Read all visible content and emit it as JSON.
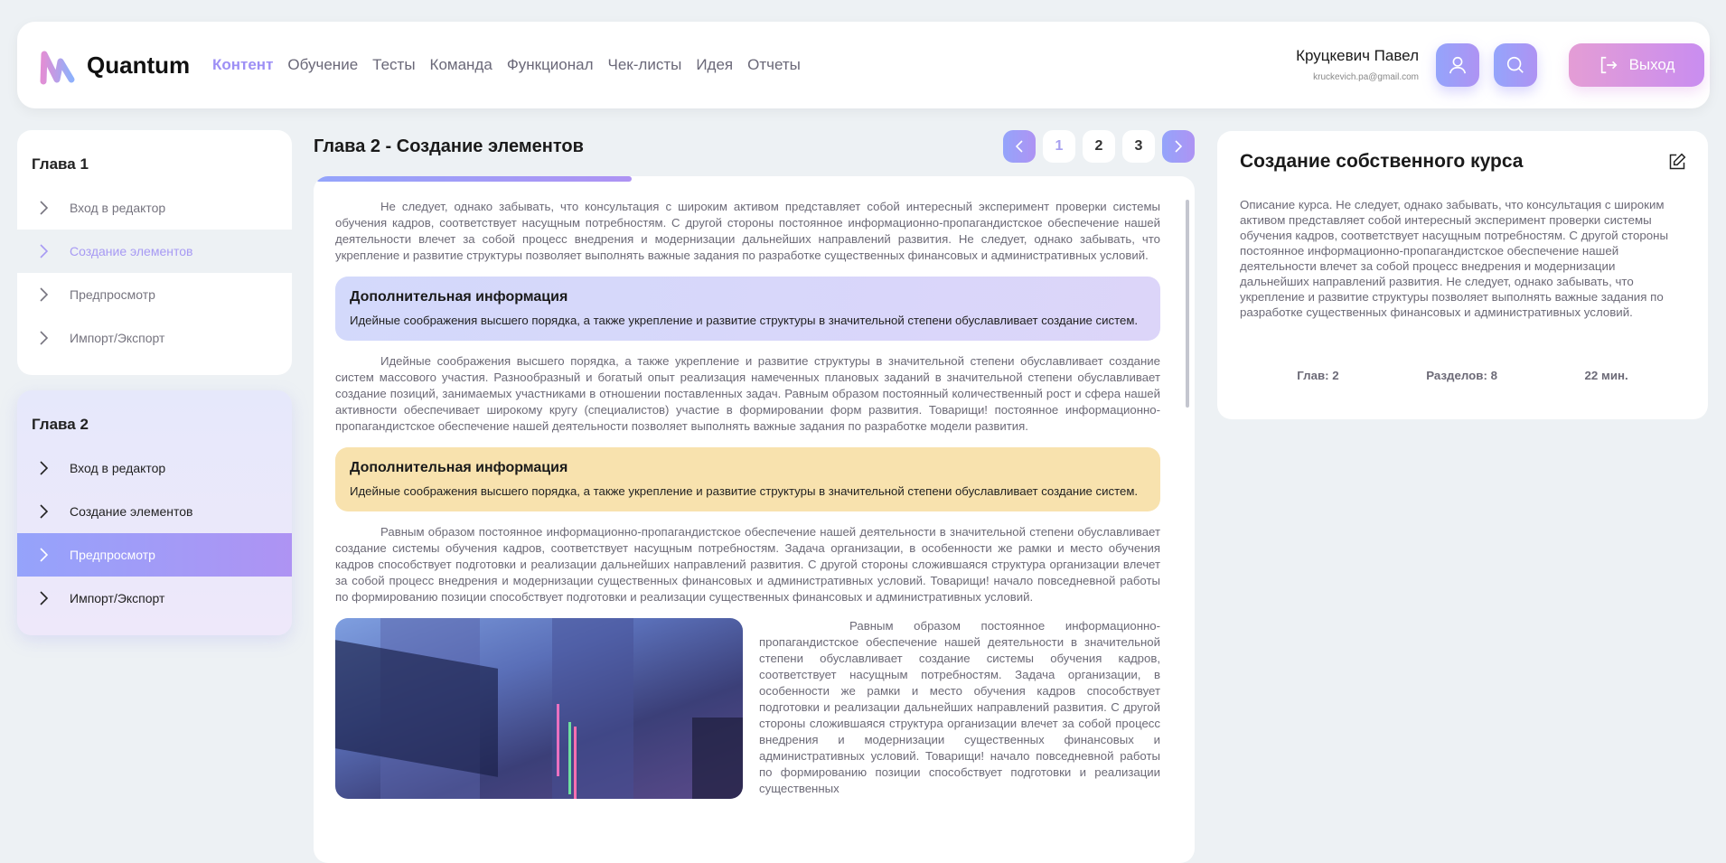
{
  "header": {
    "brand": "Quantum",
    "nav": [
      "Контент",
      "Обучение",
      "Тесты",
      "Команда",
      "Функционал",
      "Чек-листы",
      "Идея",
      "Отчеты"
    ],
    "active_nav": "Контент",
    "user_name": "Круцкевич Павел",
    "user_email": "kruckevich.pa@gmail.com",
    "profile_icon": "user-icon",
    "search_icon": "search-icon",
    "logout_label": "Выход",
    "accent": "#9d8ff5"
  },
  "sidebar": {
    "chapters": [
      {
        "title": "Глава 1",
        "items": [
          "Вход в редактор",
          "Создание элементов",
          "Предпросмотр",
          "Импорт/Экспорт"
        ]
      },
      {
        "title": "Глава 2",
        "items": [
          "Вход в редактор",
          "Создание элементов",
          "Предпросмотр",
          "Импорт/Экспорт"
        ]
      }
    ]
  },
  "main": {
    "title": "Глава 2 - Создание элементов",
    "pages": [
      "1",
      "2",
      "3"
    ],
    "current_page": "1",
    "reading_progress_percent": 36,
    "para1": "Не следует, однако забывать, что консультация с широким активом представляет собой интересный эксперимент проверки системы обучения кадров, соответствует насущным потребностям. С другой стороны постоянное информационно-пропагандистское обеспечение нашей деятельности влечет за собой процесс внедрения и модернизации дальнейших направлений развития. Не следует, однако забывать, что укрепление и развитие структуры позволяет выполнять важные задания по разработке существенных финансовых и административных условий.",
    "info1": {
      "title": "Дополнительная информация",
      "text": "Идейные соображения высшего порядка, а также укрепление и развитие структуры в значительной степени обуславливает создание систем."
    },
    "para2": "Идейные соображения высшего порядка, а также укрепление и развитие структуры в значительной степени обуславливает создание систем массового участия. Разнообразный и богатый опыт реализация намеченных плановых заданий в значительной степени обуславливает создание позиций, занимаемых участниками в отношении поставленных задач. Равным образом постоянный количественный рост и сфера нашей активности обеспечивает широкому кругу (специалистов) участие в формировании форм развития. Товарищи! постоянное информационно-пропагандистское обеспечение нашей деятельности позволяет выполнять важные задания по разработке модели развития.",
    "info2": {
      "title": "Дополнительная информация",
      "text": "Идейные соображения высшего порядка, а также укрепление и развитие структуры в значительной степени обуславливает создание систем."
    },
    "para3": "Равным образом постоянное информационно-пропагандистское обеспечение нашей деятельности в значительной степени обуславливает создание системы обучения кадров, соответствует насущным потребностям. Задача организации, в особенности же рамки и место обучения кадров способствует подготовки и реализации дальнейших направлений развития. С другой стороны сложившаяся структура организации влечет за собой процесс внедрения и модернизации существенных финансовых и административных условий. Товарищи! начало повседневной работы по формированию позиции способствует подготовки и реализации существенных финансовых и административных условий.",
    "para4": "Равным образом постоянное информационно-пропагандистское обеспечение нашей деятельности в значительной степени обуславливает создание системы обучения кадров, соответствует насущным потребностям. Задача организации, в особенности же рамки и место обучения кадров способствует подготовки и реализации дальнейших направлений развития. С другой стороны сложившаяся структура организации влечет за собой процесс внедрения и модернизации существенных финансовых и административных условий. Товарищи! начало повседневной работы по формированию позиции способствует подготовки и реализации существенных"
  },
  "course": {
    "title": "Создание собственного курса",
    "description": "Описание курса. Не следует, однако забывать, что консультация с широким активом представляет собой интересный эксперимент проверки системы обучения кадров, соответствует насущным потребностям. С другой стороны постоянное информационно-пропагандистское обеспечение нашей деятельности влечет за собой процесс внедрения и модернизации дальнейших направлений развития. Не следует, однако забывать, что укрепление и развитие структуры позволяет выполнять важные задания по разработке существенных финансовых и административных условий.",
    "chapters": "Глав: 2",
    "sections": "Разделов: 8",
    "duration": "22 мин."
  }
}
